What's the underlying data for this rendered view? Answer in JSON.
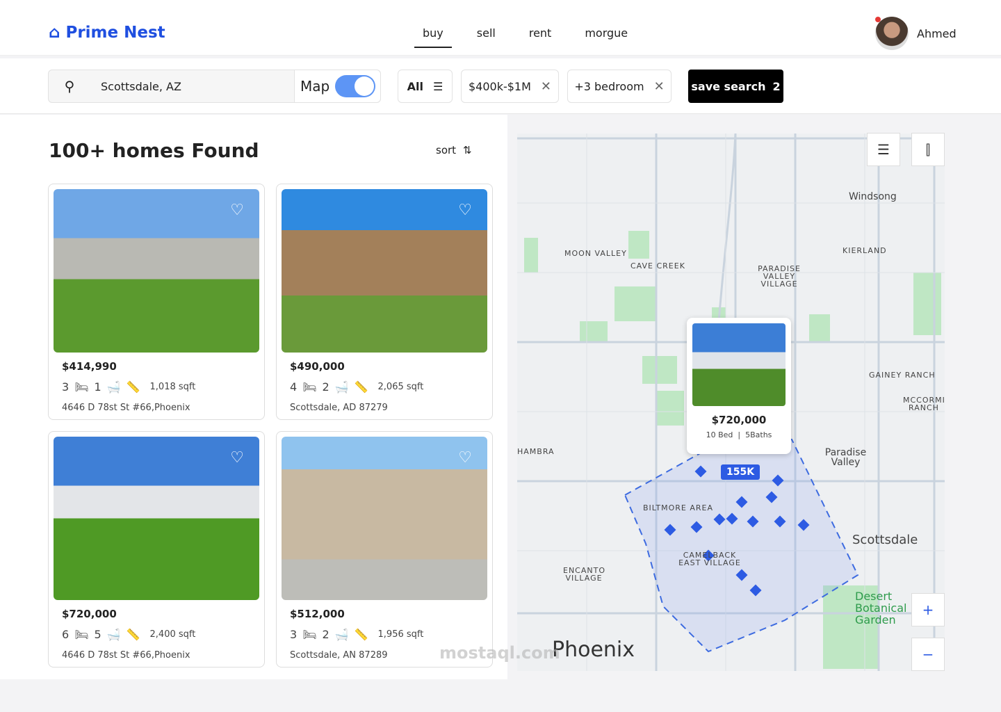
{
  "brand": {
    "name": "Prime Nest",
    "accent": "#1f4fe0"
  },
  "nav": [
    "buy",
    "sell",
    "rent",
    "morgue"
  ],
  "nav_active": "buy",
  "user": {
    "name": "Ahmed"
  },
  "search": {
    "value": "Scottsdale, AZ",
    "map_label": "Map",
    "map_on": true
  },
  "filters": {
    "all": "All",
    "price": "$400k-$1M",
    "beds": "+3 bedroom"
  },
  "save": {
    "label": "save search",
    "count": "2"
  },
  "results": {
    "title": "100+ homes Found",
    "sort": "sort"
  },
  "listings": [
    {
      "price": "$414,990",
      "beds": "3",
      "baths": "1",
      "sqft": "1,018 sqft",
      "address": "4646 D 78st St #66,Phoenix"
    },
    {
      "price": "$490,000",
      "beds": "4",
      "baths": "2",
      "sqft": "2,065  sqft",
      "address": "Scottsdale, AD 87279"
    },
    {
      "price": "$720,000",
      "beds": "6",
      "baths": "5",
      "sqft": "2,400 sqft",
      "address": "4646 D 78st St #66,Phoenix"
    },
    {
      "price": "$512,000",
      "beds": "3",
      "baths": "2",
      "sqft": "1,956  sqft",
      "address": "Scottsdale, AN 87289"
    }
  ],
  "map": {
    "labels": [
      "MOON VALLEY",
      "CAVE CREEK",
      "PARADISE VALLEY VILLAGE",
      "KIERLAND",
      "Windsong",
      "GAINEY RANCH",
      "MCCORMICK RANCH",
      "Paradise Valley",
      "BILTMORE AREA",
      "CAMELBACK EAST VILLAGE",
      "ENCANTO VILLAGE",
      "Scottsdale",
      "Desert Botanical Garden",
      "Phoenix",
      "HAMBRA"
    ],
    "cluster": "155K",
    "popup": {
      "price": "$720,000",
      "beds": "10 Bed",
      "baths": "5Baths"
    },
    "zoom_in": "+",
    "zoom_out": "−"
  },
  "watermark": "mostaql.com"
}
